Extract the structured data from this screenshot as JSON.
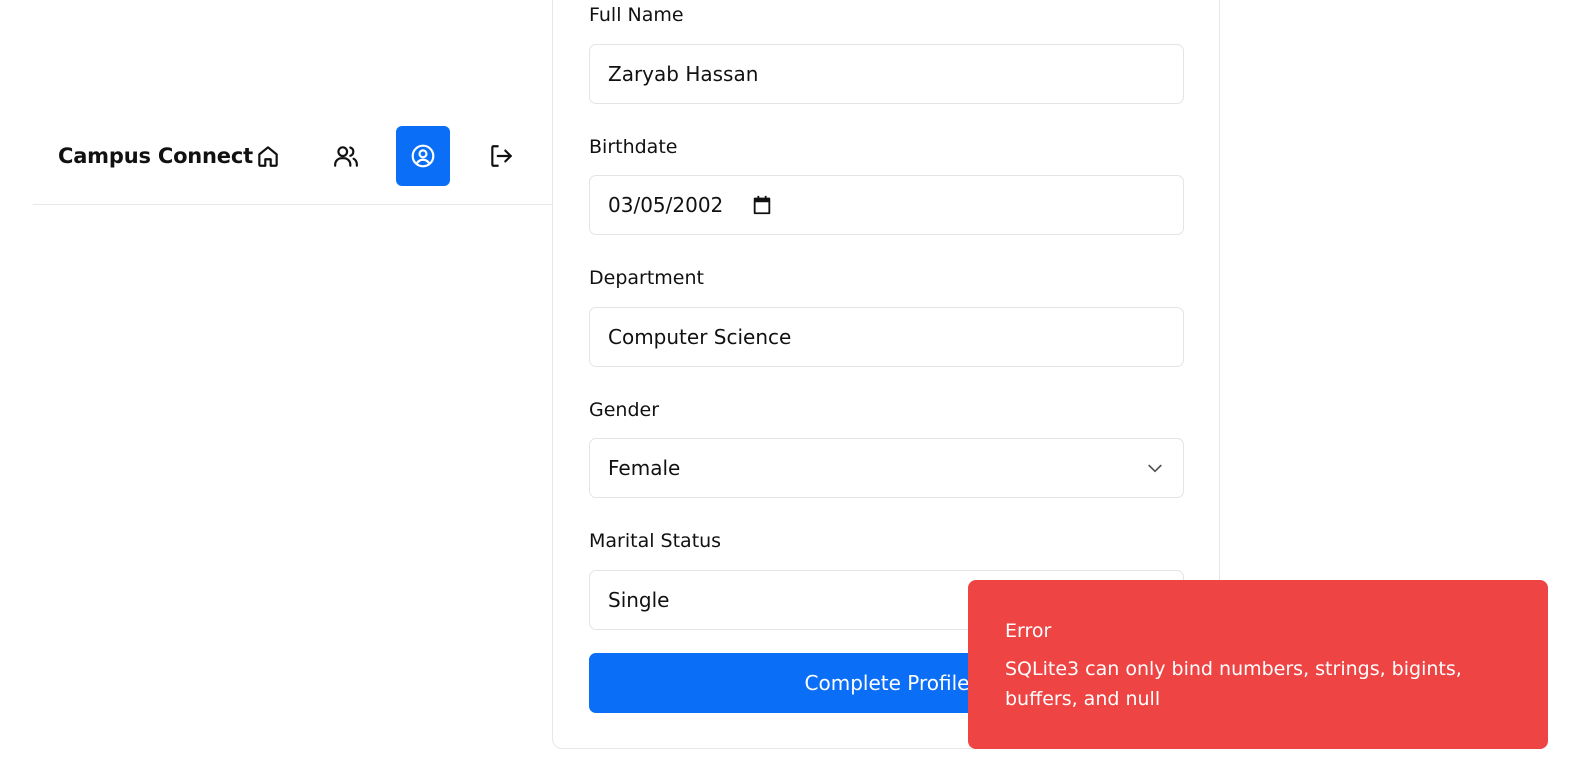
{
  "nav": {
    "brand": "Campus Connect",
    "items": [
      {
        "icon": "home-icon",
        "active": false
      },
      {
        "icon": "users-icon",
        "active": false
      },
      {
        "icon": "user-circle-icon",
        "active": true
      },
      {
        "icon": "logout-icon",
        "active": false
      }
    ]
  },
  "form": {
    "full_name_label": "Full Name",
    "full_name_value": "Zaryab Hassan",
    "birthdate_label": "Birthdate",
    "birthdate_value": "03/05/2002",
    "department_label": "Department",
    "department_value": "Computer Science",
    "gender_label": "Gender",
    "gender_value": "Female",
    "marital_label": "Marital Status",
    "marital_value": "Single",
    "submit_label": "Complete Profile"
  },
  "toast": {
    "title": "Error",
    "message": "SQLite3 can only bind numbers, strings, bigints, buffers, and null"
  },
  "colors": {
    "accent": "#0b6ef6",
    "error": "#ef4444"
  }
}
